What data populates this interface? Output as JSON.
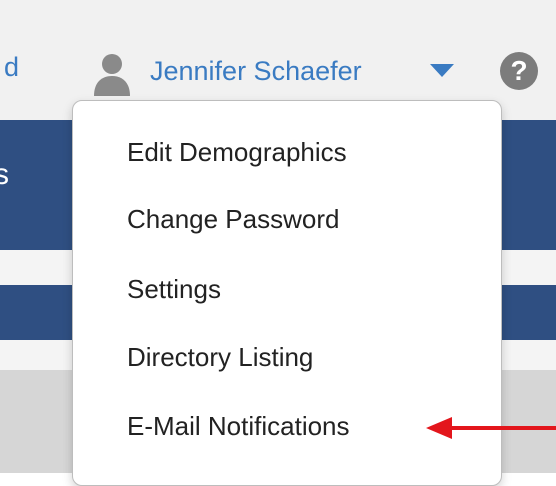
{
  "header": {
    "partial_link_text": "d",
    "user_name": "Jennifer Schaefer",
    "user_icon": "user-avatar-icon",
    "caret_icon": "caret-down-icon",
    "help_icon": "question-mark-icon",
    "help_glyph": "?"
  },
  "background": {
    "partial_letter": "s"
  },
  "user_menu": {
    "items": [
      {
        "label": "Edit Demographics"
      },
      {
        "label": "Change Password"
      },
      {
        "label": "Settings"
      },
      {
        "label": "Directory Listing"
      },
      {
        "label": "E-Mail Notifications"
      }
    ],
    "highlighted_item": "E-Mail Notifications"
  },
  "colors": {
    "link_blue": "#3a7bc2",
    "nav_band": "#2f4f82",
    "annotation_arrow": "#e3161c"
  }
}
